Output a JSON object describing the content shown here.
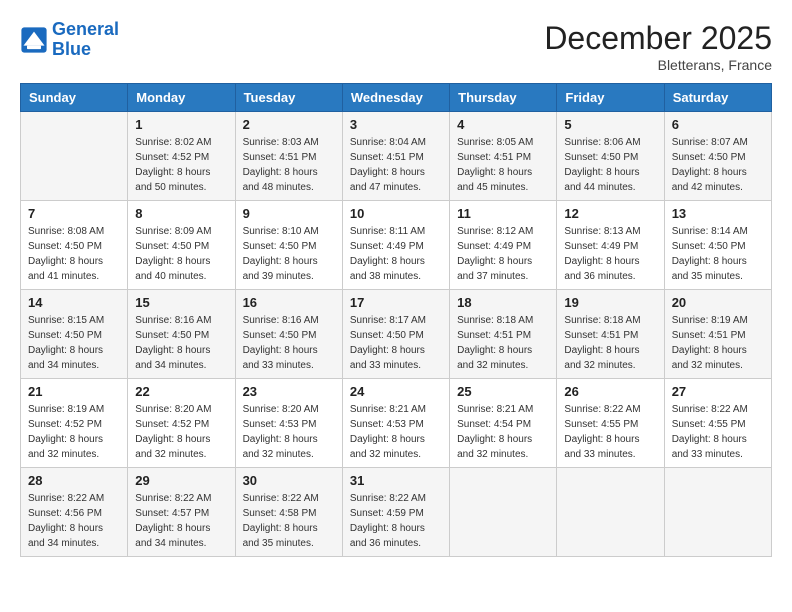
{
  "logo": {
    "line1": "General",
    "line2": "Blue"
  },
  "title": "December 2025",
  "location": "Bletterans, France",
  "days_header": [
    "Sunday",
    "Monday",
    "Tuesday",
    "Wednesday",
    "Thursday",
    "Friday",
    "Saturday"
  ],
  "weeks": [
    [
      {
        "num": "",
        "info": ""
      },
      {
        "num": "1",
        "info": "Sunrise: 8:02 AM\nSunset: 4:52 PM\nDaylight: 8 hours\nand 50 minutes."
      },
      {
        "num": "2",
        "info": "Sunrise: 8:03 AM\nSunset: 4:51 PM\nDaylight: 8 hours\nand 48 minutes."
      },
      {
        "num": "3",
        "info": "Sunrise: 8:04 AM\nSunset: 4:51 PM\nDaylight: 8 hours\nand 47 minutes."
      },
      {
        "num": "4",
        "info": "Sunrise: 8:05 AM\nSunset: 4:51 PM\nDaylight: 8 hours\nand 45 minutes."
      },
      {
        "num": "5",
        "info": "Sunrise: 8:06 AM\nSunset: 4:50 PM\nDaylight: 8 hours\nand 44 minutes."
      },
      {
        "num": "6",
        "info": "Sunrise: 8:07 AM\nSunset: 4:50 PM\nDaylight: 8 hours\nand 42 minutes."
      }
    ],
    [
      {
        "num": "7",
        "info": "Sunrise: 8:08 AM\nSunset: 4:50 PM\nDaylight: 8 hours\nand 41 minutes."
      },
      {
        "num": "8",
        "info": "Sunrise: 8:09 AM\nSunset: 4:50 PM\nDaylight: 8 hours\nand 40 minutes."
      },
      {
        "num": "9",
        "info": "Sunrise: 8:10 AM\nSunset: 4:50 PM\nDaylight: 8 hours\nand 39 minutes."
      },
      {
        "num": "10",
        "info": "Sunrise: 8:11 AM\nSunset: 4:49 PM\nDaylight: 8 hours\nand 38 minutes."
      },
      {
        "num": "11",
        "info": "Sunrise: 8:12 AM\nSunset: 4:49 PM\nDaylight: 8 hours\nand 37 minutes."
      },
      {
        "num": "12",
        "info": "Sunrise: 8:13 AM\nSunset: 4:49 PM\nDaylight: 8 hours\nand 36 minutes."
      },
      {
        "num": "13",
        "info": "Sunrise: 8:14 AM\nSunset: 4:50 PM\nDaylight: 8 hours\nand 35 minutes."
      }
    ],
    [
      {
        "num": "14",
        "info": "Sunrise: 8:15 AM\nSunset: 4:50 PM\nDaylight: 8 hours\nand 34 minutes."
      },
      {
        "num": "15",
        "info": "Sunrise: 8:16 AM\nSunset: 4:50 PM\nDaylight: 8 hours\nand 34 minutes."
      },
      {
        "num": "16",
        "info": "Sunrise: 8:16 AM\nSunset: 4:50 PM\nDaylight: 8 hours\nand 33 minutes."
      },
      {
        "num": "17",
        "info": "Sunrise: 8:17 AM\nSunset: 4:50 PM\nDaylight: 8 hours\nand 33 minutes."
      },
      {
        "num": "18",
        "info": "Sunrise: 8:18 AM\nSunset: 4:51 PM\nDaylight: 8 hours\nand 32 minutes."
      },
      {
        "num": "19",
        "info": "Sunrise: 8:18 AM\nSunset: 4:51 PM\nDaylight: 8 hours\nand 32 minutes."
      },
      {
        "num": "20",
        "info": "Sunrise: 8:19 AM\nSunset: 4:51 PM\nDaylight: 8 hours\nand 32 minutes."
      }
    ],
    [
      {
        "num": "21",
        "info": "Sunrise: 8:19 AM\nSunset: 4:52 PM\nDaylight: 8 hours\nand 32 minutes."
      },
      {
        "num": "22",
        "info": "Sunrise: 8:20 AM\nSunset: 4:52 PM\nDaylight: 8 hours\nand 32 minutes."
      },
      {
        "num": "23",
        "info": "Sunrise: 8:20 AM\nSunset: 4:53 PM\nDaylight: 8 hours\nand 32 minutes."
      },
      {
        "num": "24",
        "info": "Sunrise: 8:21 AM\nSunset: 4:53 PM\nDaylight: 8 hours\nand 32 minutes."
      },
      {
        "num": "25",
        "info": "Sunrise: 8:21 AM\nSunset: 4:54 PM\nDaylight: 8 hours\nand 32 minutes."
      },
      {
        "num": "26",
        "info": "Sunrise: 8:22 AM\nSunset: 4:55 PM\nDaylight: 8 hours\nand 33 minutes."
      },
      {
        "num": "27",
        "info": "Sunrise: 8:22 AM\nSunset: 4:55 PM\nDaylight: 8 hours\nand 33 minutes."
      }
    ],
    [
      {
        "num": "28",
        "info": "Sunrise: 8:22 AM\nSunset: 4:56 PM\nDaylight: 8 hours\nand 34 minutes."
      },
      {
        "num": "29",
        "info": "Sunrise: 8:22 AM\nSunset: 4:57 PM\nDaylight: 8 hours\nand 34 minutes."
      },
      {
        "num": "30",
        "info": "Sunrise: 8:22 AM\nSunset: 4:58 PM\nDaylight: 8 hours\nand 35 minutes."
      },
      {
        "num": "31",
        "info": "Sunrise: 8:22 AM\nSunset: 4:59 PM\nDaylight: 8 hours\nand 36 minutes."
      },
      {
        "num": "",
        "info": ""
      },
      {
        "num": "",
        "info": ""
      },
      {
        "num": "",
        "info": ""
      }
    ]
  ]
}
